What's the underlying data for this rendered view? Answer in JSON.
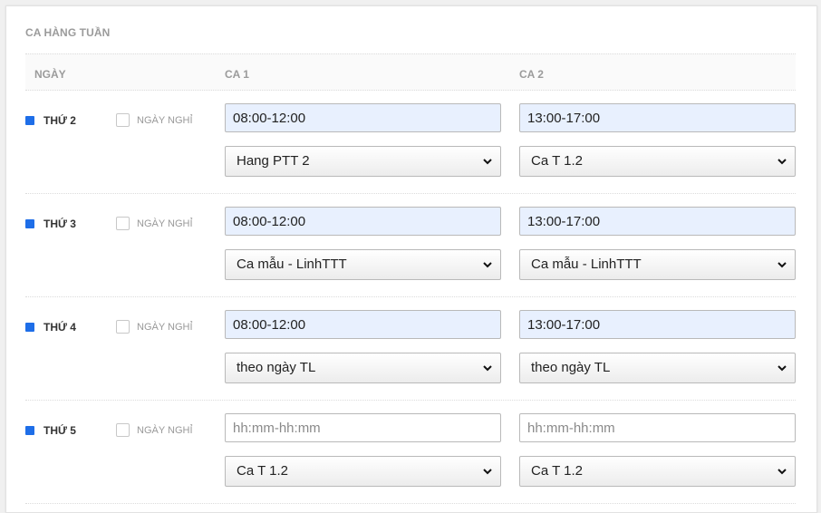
{
  "section": {
    "title": "CA HÀNG TUẦN"
  },
  "columns": {
    "day": "NGÀY",
    "ca1": "CA 1",
    "ca2": "CA 2"
  },
  "colors": {
    "day_marker": "#1e6ee8",
    "input_filled_bg": "#e8f0fe"
  },
  "rows": [
    {
      "day": "THỨ 2",
      "dayoff_label": "NGÀY NGHỈ",
      "dayoff_checked": false,
      "ca1": {
        "time": "08:00-12:00",
        "placeholder": "hh:mm-hh:mm",
        "shift": "Hang PTT 2"
      },
      "ca2": {
        "time": "13:00-17:00",
        "placeholder": "hh:mm-hh:mm",
        "shift": "Ca T 1.2"
      }
    },
    {
      "day": "THỨ 3",
      "dayoff_label": "NGÀY NGHỈ",
      "dayoff_checked": false,
      "ca1": {
        "time": "08:00-12:00",
        "placeholder": "hh:mm-hh:mm",
        "shift": "Ca mẫu - LinhTTT"
      },
      "ca2": {
        "time": "13:00-17:00",
        "placeholder": "hh:mm-hh:mm",
        "shift": "Ca mẫu - LinhTTT"
      }
    },
    {
      "day": "THỨ 4",
      "dayoff_label": "NGÀY NGHỈ",
      "dayoff_checked": false,
      "ca1": {
        "time": "08:00-12:00",
        "placeholder": "hh:mm-hh:mm",
        "shift": "theo ngày TL"
      },
      "ca2": {
        "time": "13:00-17:00",
        "placeholder": "hh:mm-hh:mm",
        "shift": "theo ngày TL"
      }
    },
    {
      "day": "THỨ 5",
      "dayoff_label": "NGÀY NGHỈ",
      "dayoff_checked": false,
      "ca1": {
        "time": "",
        "placeholder": "hh:mm-hh:mm",
        "shift": "Ca T 1.2"
      },
      "ca2": {
        "time": "",
        "placeholder": "hh:mm-hh:mm",
        "shift": "Ca T 1.2"
      }
    }
  ]
}
